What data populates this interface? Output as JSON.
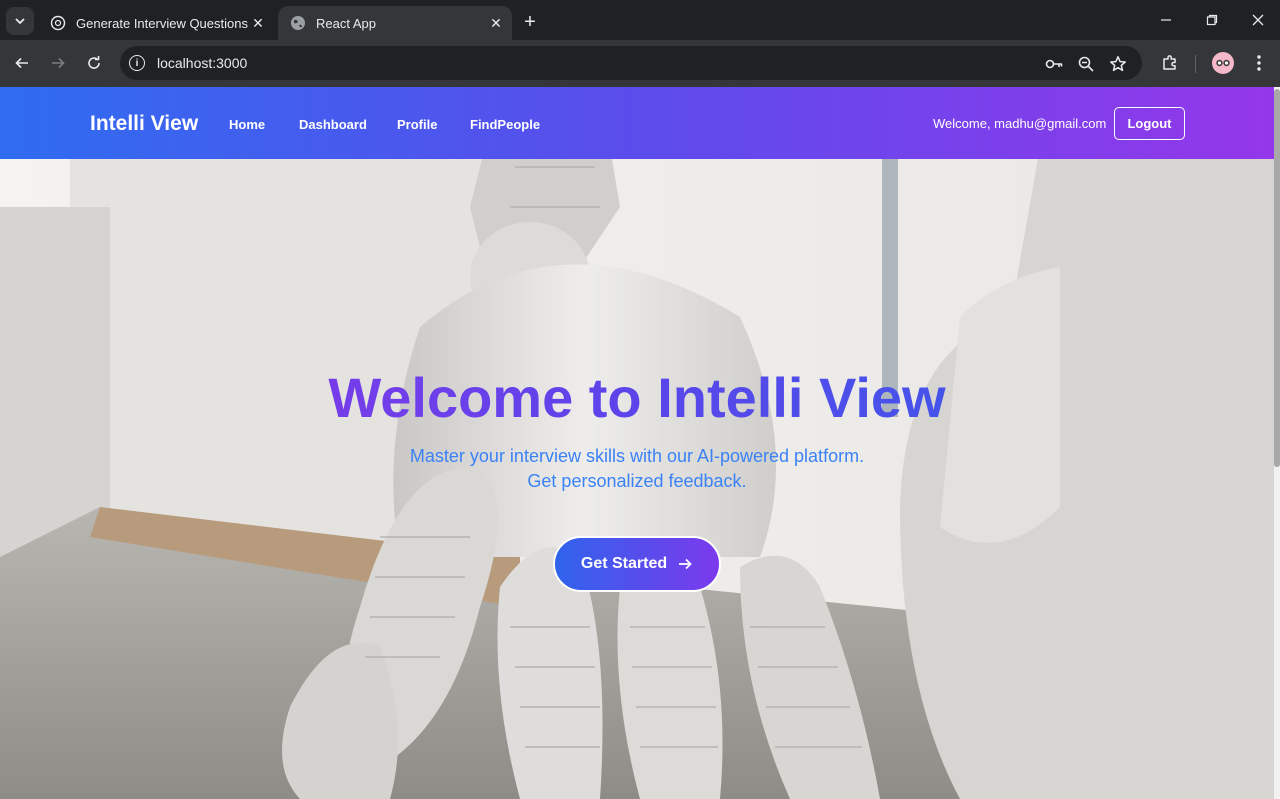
{
  "browser": {
    "tabs": [
      {
        "title": "Generate Interview Questions",
        "icon": "chatgpt-icon",
        "active": false
      },
      {
        "title": "React App",
        "icon": "globe-icon",
        "active": true
      }
    ],
    "url": "localhost:3000"
  },
  "navbar": {
    "brand": "Intelli View",
    "links": [
      "Home",
      "Dashboard",
      "Profile",
      "FindPeople"
    ],
    "welcome": "Welcome, madhu@gmail.com",
    "logout": "Logout"
  },
  "hero": {
    "title": "Welcome to Intelli View",
    "subtitle_line1": "Master your interview skills with our AI-powered platform.",
    "subtitle_line2": "Get personalized feedback.",
    "cta": "Get Started",
    "cta_icon": "arrow-right-icon",
    "background": "robot-hand-photo"
  },
  "colors": {
    "nav_start": "#2f6cf0",
    "nav_end": "#9437ea",
    "subtitle": "#3b82f6"
  }
}
